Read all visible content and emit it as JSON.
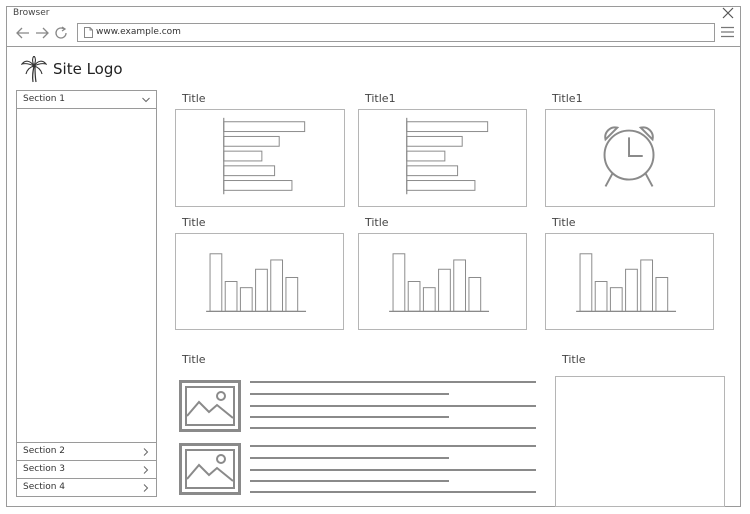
{
  "browser": {
    "title": "Browser",
    "url": "www.example.com",
    "close_icon": "close-icon",
    "back_icon": "arrow-left-icon",
    "forward_icon": "arrow-right-icon",
    "reload_icon": "reload-icon",
    "menu_icon": "hamburger-menu-icon"
  },
  "site": {
    "logo_text": "Site Logo",
    "logo_icon": "palm-tree-icon"
  },
  "sidebar": {
    "open_section": "Section 1",
    "sections": [
      "Section 2",
      "Section 3",
      "Section 4"
    ]
  },
  "cards": [
    {
      "title": "Title",
      "kind": "horizontal-bar-chart",
      "values": [
        0.7,
        0.48,
        0.33,
        0.44,
        0.59
      ]
    },
    {
      "title": "Title1",
      "kind": "horizontal-bar-chart",
      "values": [
        0.7,
        0.48,
        0.33,
        0.44,
        0.59
      ]
    },
    {
      "title": "Title1",
      "kind": "alarm-clock-icon"
    },
    {
      "title": "Title",
      "kind": "vertical-bar-chart",
      "values": [
        0.56,
        0.29,
        0.23,
        0.41,
        0.5,
        0.33
      ]
    },
    {
      "title": "Title",
      "kind": "vertical-bar-chart",
      "values": [
        0.56,
        0.29,
        0.23,
        0.41,
        0.5,
        0.33
      ]
    },
    {
      "title": "Title",
      "kind": "vertical-bar-chart",
      "values": [
        0.56,
        0.29,
        0.23,
        0.41,
        0.5,
        0.33
      ]
    }
  ],
  "list_panel": {
    "title": "Title",
    "items": [
      {
        "icon": "image-placeholder-icon"
      },
      {
        "icon": "image-placeholder-icon"
      }
    ]
  },
  "side_panel": {
    "title": "Title"
  },
  "colors": {
    "line": "#9a9a9a",
    "mark": "#8a8a8a",
    "text": "#333333"
  }
}
